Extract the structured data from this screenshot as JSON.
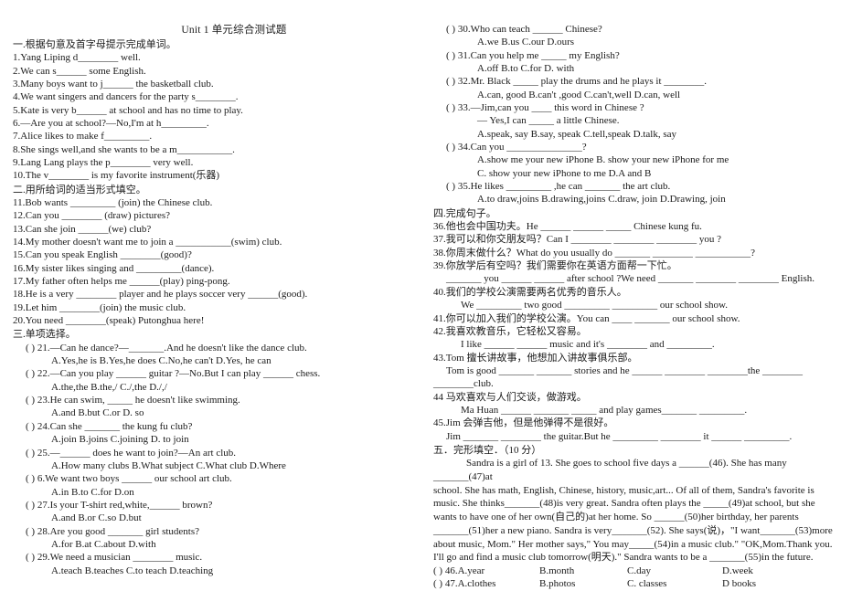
{
  "document": {
    "title": "Unit 1  单元综合测试题"
  },
  "section1": {
    "heading": "一.根据句意及首字母提示完成单词。",
    "items": [
      "1.Yang Liping d________ well.",
      "2.We can s______ some English.",
      "3.Many boys want to j______ the basketball club.",
      "4.We want singers and dancers for the party s________.",
      "5.Kate is very b______ at school and has no time to play.",
      "6.—Are you at school?—No,I'm at h_________.",
      "7.Alice likes to make f_________.",
      "8.She sings well,and she wants to be a m___________.",
      "9.Lang Lang plays the p________ very well.",
      "10.The v________ is my favorite instrument(乐器)"
    ]
  },
  "section2": {
    "heading": "二.用所给词的适当形式填空。",
    "items": [
      "11.Bob wants _________ (join) the Chinese club.",
      "12.Can you ________ (draw) pictures?",
      "13.Can she join ______(we) club?",
      "14.My mother doesn't want me to join a ___________(swim) club.",
      "15.Can you speak English ________(good)?",
      "16.My sister likes singing and _________(dance).",
      "17.My father often helps me ______(play) ping-pong.",
      "18.He is a very ________ player and he plays soccer very ______(good).",
      "19.Let him ________(join) the music club.",
      "20.You need ________(speak) Putonghua here!"
    ]
  },
  "section3": {
    "heading": "三.单项选择。",
    "questions": [
      {
        "stem": "(      ) 21.—Can he dance?—_______.And he doesn't like the dance club.",
        "options": "A.Yes,he is      B.Yes,he does   C.No,he can't     D.Yes, he can"
      },
      {
        "stem": "(      ) 22.—Can you play ______ guitar ?—No.But I can play ______ chess.",
        "options": "A.the,the   B.the,/    C./,the        D./,/"
      },
      {
        "stem": "(      ) 23.He can swim, _____ he doesn't like swimming.",
        "options": "A.and       B.but       C.or      D. so"
      },
      {
        "stem": "(      ) 24.Can she _______ the kung fu club?",
        "options": "A.join     B.joins     C.joining     D. to join"
      },
      {
        "stem": "(      ) 25.—______ does he want to join?—An art club.",
        "options": "A.How many clubs   B.What subject     C.What club   D.Where"
      },
      {
        "stem": "(      ) 6.We want two boys ______ our school art club.",
        "options": "A.in     B.to     C.for      D.on"
      },
      {
        "stem": "(      ) 27.Is your T-shirt red,white,______ brown?",
        "options": "A.and       B.or       C.so       D.but"
      },
      {
        "stem": "(      ) 28.Are you good _______ girl students?",
        "options": "A.for     B.at      C.about      D.with"
      },
      {
        "stem": "(      ) 29.We need a musician ________ music.",
        "options": "A.teach       B.teaches    C.to teach     D.teaching"
      }
    ],
    "questions_right": [
      {
        "stem": "(      ) 30.Who can teach ______ Chinese?",
        "options": "A.we     B.us       C.our     D.ours"
      },
      {
        "stem": "(      ) 31.Can you help me _____ my English?",
        "options": "A.off    B.to     C.for     D. with"
      },
      {
        "stem": "(      ) 32.Mr. Black _____ play the drums and he plays it ________.",
        "options": "A.can, good     B.can't ,good     C.can't,well     D.can, well"
      },
      {
        "stem": "(      ) 33.—Jim,can you ____ this word in Chinese ?",
        "stem2": "— Yes,I can _____ a little Chinese.",
        "options": "A.speak, say   B.say, speak   C.tell,speak     D.talk, say"
      },
      {
        "stem": "(      ) 34.Can you _______________?",
        "options": "A.show me    your new iPhone              B. show your new iPhone for me",
        "options2": "C. show your new iPhone to me              D.A and B"
      },
      {
        "stem": "(      ) 35.He likes _________ ,he can _______ the art club.",
        "options": "A.to draw,joins   B.drawing,joins    C.draw, join       D.Drawing, join"
      }
    ]
  },
  "section4": {
    "heading": "四.完成句子。",
    "items": [
      {
        "text": "36.他也会中国功夫。He ______ ______ _____ Chinese kung fu."
      },
      {
        "text": "37.我可以和你交朋友吗？Can I ________ ________ ________ you ?"
      },
      {
        "text": "38.你周末做什么？What do you usually do _______ ________ ___________?"
      },
      {
        "text": "39.你放学后有空吗？我们需要你在英语方面帮一下忙。"
      },
      {
        "text": "_______ you ______ ______ after school ?We need _______ ________ ________ English.",
        "indent": true
      },
      {
        "text": "40.我们的学校公演需要两名优秀的音乐人。"
      },
      {
        "text": "We _________ two good _________ _________ our school show.",
        "indent": true
      },
      {
        "text": "41.你可以加入我们的学校公演。You can ____ _______ our school show."
      },
      {
        "text": "42.我喜欢教音乐，它轻松又容易。"
      },
      {
        "text": "I like ______ ______ music and it's ________ and _________.",
        "indent": true
      },
      {
        "text": "43.Tom 擅长讲故事，他想加入讲故事俱乐部。"
      },
      {
        "text": "Tom  is  good  _______  _______  stories  and  he  ______  ________  ________the  ________",
        "indent": true
      },
      {
        "text": "________club."
      },
      {
        "text": "44 马欢喜欢与人们交谈，做游戏。"
      },
      {
        "text": "Ma Huan ______ _______  _____ and play games_______ _________.",
        "indent": true
      },
      {
        "text": "45.Jim 会弹吉他，但是他弹得不是很好。"
      },
      {
        "text": "Jim _______ ________ the guitar.But he _________ ________ it ______ _________.",
        "indent": true
      }
    ]
  },
  "section5": {
    "heading": "五．完形填空．（10 分）",
    "passage_lines": [
      "Sandra is a girl of 13. She goes to school five days a ______(46). She has many _______(47)at",
      "school. She has math, English, Chinese, history, music,art... Of all of them, Sandra's favorite is",
      "music. She thinks_______(48)is very great. Sandra often plays the _____(49)at school, but she",
      "wants to have one of her own(自己的)at her home. So ______(50)her birthday, her parents",
      "_______(51)her a new piano. Sandra is very_______(52). She says(说)，\"I want_______(53)more",
      "about music, Mom.\" Her mother says,\" You may_____(54)in a music club.\" \"OK,Mom.Thank you.",
      "I'll go and find a music club tomorrow(明天).\" Sandra wants to be a _______(55)in the future."
    ],
    "choices": [
      {
        "stem": "(      ) 46.A.year",
        "b": "B.month",
        "c": "C.day",
        "d": "D.week"
      },
      {
        "stem": "(      ) 47.A.clothes",
        "b": "B.photos",
        "c": "C. classes",
        "d": "D books"
      }
    ]
  }
}
